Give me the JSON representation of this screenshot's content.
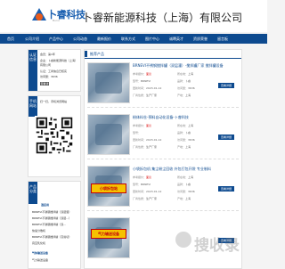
{
  "header": {
    "logo_text": "卜睿科技",
    "logo_sub": "Burui",
    "company_name": "卜睿新能源科技（上海）有限公司"
  },
  "nav": [
    "首页",
    "公司介绍",
    "产品中心",
    "公司动态",
    "最新报价",
    "联系方式",
    "图片中心",
    "诚聘英才",
    "资质荣誉",
    "留言板"
  ],
  "sidebar": {
    "info_tab": "认证信息",
    "info_lines": [
      "会员：第1年",
      "企业：卜睿新能源科技（上海）",
      "有限公司",
      "认证：工商信息已核实",
      "访问量：3636"
    ],
    "more": "查看详细",
    "qr_tab": "手机网站",
    "qr_caption": "扫一扫，手机浏览网站",
    "cat_tab": "产品分类",
    "categories": [
      {
        "label": "酒店用",
        "bold": true
      },
      {
        "label": "BRNEVI不锈钢搅拌罐（双层灌）"
      },
      {
        "label": "BRNEVI不锈钢搅拌罐（双层...）"
      },
      {
        "label": "BRNEVI不锈钢搅拌罐（双..."
      },
      {
        "label": "快速分散机"
      },
      {
        "label": "BRNEVI不锈钢搅拌罐（高剪切）"
      },
      {
        "label": "真空乳化机"
      },
      {
        "label": "气体输送设备",
        "bold": true
      },
      {
        "label": "气力输送设备"
      }
    ]
  },
  "main": {
    "title": "推荐产品",
    "products": [
      {
        "name": "BRNEVI不锈钢搅拌罐（双层灌）-搅拌罐厂家 搅拌罐设备",
        "lines": [
          [
            "参考报价：",
            "面议",
            "所在地：",
            "上海"
          ],
          [
            "型号：",
            "BRNEVI",
            "品牌：",
            "卜睿"
          ],
          [
            "更新时间：",
            "2023-01-12",
            "访问量：",
            "3636"
          ],
          [
            "厂商性质：",
            "生产厂家",
            "产地：",
            "上海"
          ]
        ],
        "button": "查看详细"
      },
      {
        "name": "粉体料仓-预料自动化设备-卜睿科技",
        "lines": [
          [
            "参考报价：",
            "面议",
            "所在地：",
            "上海"
          ],
          [
            "型号：",
            "",
            "品牌：",
            "卜睿"
          ],
          [
            "更新时间：",
            "2023-01-12",
            "访问量：",
            "3636"
          ],
          [
            "厂商性质：",
            "生产厂家",
            "产地：",
            "上海"
          ]
        ],
        "button": "查看详细"
      },
      {
        "name": "小袋拆包机 集尘粉尘回收 外包打包开袋 专业制料",
        "badge": "小袋拆包站",
        "lines": [
          [
            "参考报价：",
            "面议",
            "所在地：",
            "上海"
          ],
          [
            "型号：",
            "BRNEVI",
            "品牌：",
            "卜睿"
          ],
          [
            "更新时间：",
            "2023-01-12",
            "访问量：",
            "3636"
          ],
          [
            "厂商性质：",
            "生产厂家",
            "产地：",
            "上海"
          ]
        ],
        "button": "查看详细"
      },
      {
        "name": "",
        "badge": "气力输送设备",
        "lines": [],
        "button": "查看详细"
      }
    ]
  },
  "watermark": "搜收录",
  "colors": {
    "nav": "#0d4a8f",
    "logo_blue": "#1a5fb0",
    "logo_orange": "#e95b1b",
    "price_red": "#dd1111",
    "badge_yellow": "#f6c200"
  }
}
